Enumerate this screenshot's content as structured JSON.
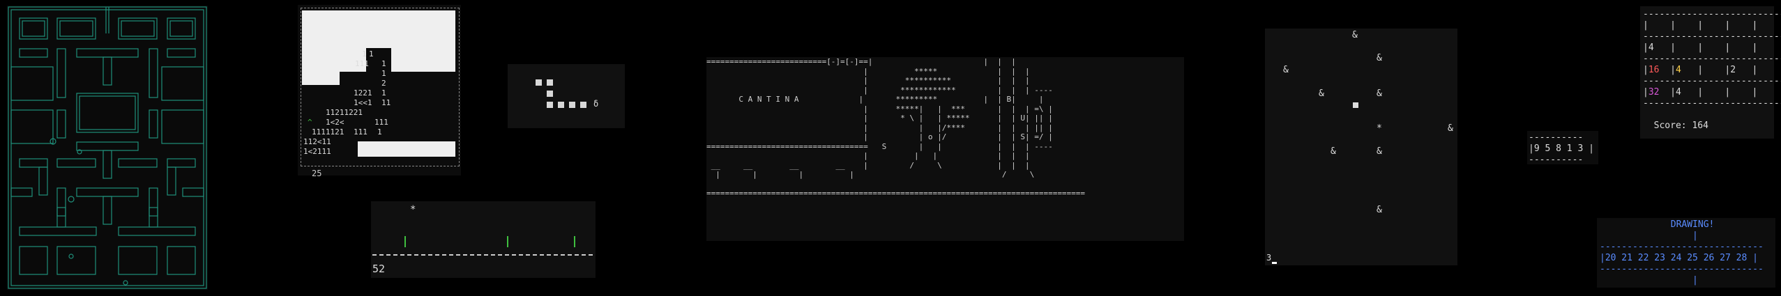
{
  "mines": {
    "numbers": [
      "1",
      "1",
      "111",
      "1",
      "1",
      "2",
      "1221",
      "1",
      "1<<1",
      "11",
      "11211221",
      "^",
      "1<2<",
      "111",
      "1111121",
      "111",
      "1",
      "112<11",
      "1<2111"
    ],
    "count": "25"
  },
  "snake": {
    "food": "δ"
  },
  "jumper": {
    "star": "*",
    "score": "52"
  },
  "cantina": {
    "title": "C A N T I N A",
    "npc": "S",
    "sign": "[-]=[-]"
  },
  "amp": {
    "glyph": "&",
    "star": "*",
    "level": "3"
  },
  "digits": {
    "row": "|9 5 8 1 3 |"
  },
  "grid2048": {
    "rows": [
      [
        "4",
        "",
        "",
        "",
        ""
      ],
      [
        "16",
        "4",
        "",
        "2",
        ""
      ],
      [
        "32",
        "4",
        "",
        "",
        ""
      ]
    ],
    "score_label": "Score: 164"
  },
  "drawing": {
    "title": "DRAWING!",
    "numbers": "|20 21 22 23 24 25 26 27 28 |"
  },
  "colors": {
    "maze_wall": "#1f8f7a",
    "post_green": "#3fbf3f",
    "drawing_blue": "#5a8cff",
    "red": "#ff5a5a",
    "yellow": "#ffd24a",
    "magenta": "#d858d8"
  }
}
